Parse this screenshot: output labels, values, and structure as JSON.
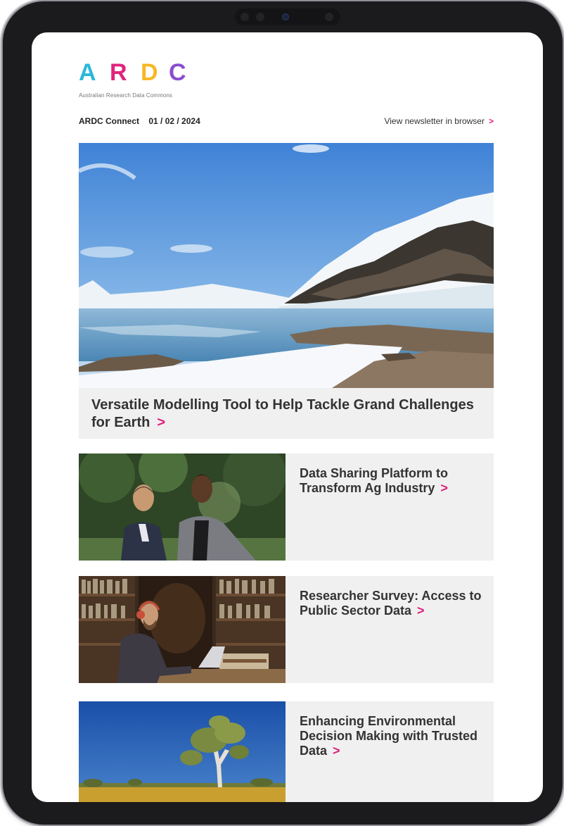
{
  "brand": {
    "logo_letters": [
      "A",
      "R",
      "D",
      "C"
    ],
    "logo_colors": [
      "#2bb8d9",
      "#e0247c",
      "#f7b825",
      "#8a4fd0"
    ],
    "tagline": "Australian Research Data Commons"
  },
  "header": {
    "newsletter_name": "ARDC Connect",
    "date": "01 / 02 / 2024",
    "browser_link": "View newsletter in browser",
    "chevron": ">"
  },
  "hero": {
    "title": "Versatile Modelling Tool to Help Tackle Grand Challenges for Earth",
    "chevron": ">"
  },
  "articles": [
    {
      "title": "Data Sharing Platform to Transform Ag Industry",
      "chevron": ">"
    },
    {
      "title": "Researcher Survey: Access to Public Sector Data",
      "chevron": ">"
    },
    {
      "title": "Enhancing Environmental Decision Making with Trusted Data",
      "chevron": ">"
    }
  ],
  "colors": {
    "accent": "#e01e7c",
    "card_bg": "#f0f0f0",
    "text": "#333333"
  }
}
